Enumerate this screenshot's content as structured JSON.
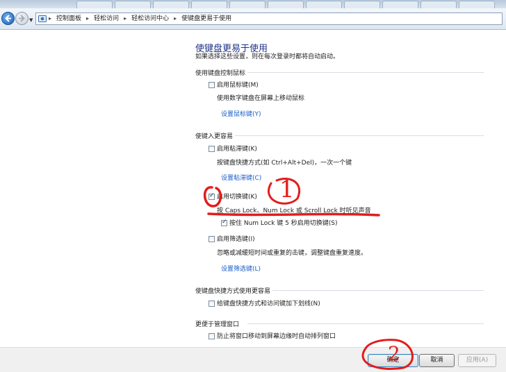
{
  "breadcrumbs": [
    "控制面板",
    "轻松访问",
    "轻松访问中心",
    "使键盘更易于使用"
  ],
  "header": {
    "title": "使键盘更易于使用",
    "subtitle": "如果选择这些设置，则在每次登录时都将自动启动。"
  },
  "sections": {
    "mouse_keys": {
      "heading": "使用键盘控制鼠标",
      "checkbox_label": "启用鼠标键(M)",
      "checked": false,
      "description": "使用数字键盘在屏幕上移动鼠标",
      "link": "设置鼠标键(Y)"
    },
    "easier_typing": {
      "heading": "使键入更容易",
      "sticky": {
        "checkbox_label": "启用粘滞键(K)",
        "checked": false,
        "description": "按键盘快捷方式(如 Ctrl+Alt+Del)，一次一个键",
        "link": "设置粘滞键(C)"
      },
      "toggle": {
        "checkbox_label": "启用切换键(K)",
        "checked": true,
        "description": "按 Caps Lock、Num Lock 或 Scroll Lock 时听见声音",
        "sub_checkbox_label": "按住 Num Lock 键 5 秒启用切换键(S)",
        "sub_checked": true
      },
      "filter": {
        "checkbox_label": "启用筛选键(I)",
        "checked": false,
        "description": "忽略或减缓短时间或重复的击键，调整键盘重复速度。",
        "link": "设置筛选键(L)"
      }
    },
    "shortcuts": {
      "heading": "使键盘快捷方式使用更容易",
      "checkbox_label": "给键盘快捷方式和访问键加下划线(N)",
      "checked": false
    },
    "windows": {
      "heading": "更便于管理窗口",
      "checkbox_label": "防止将窗口移动到屏幕边缘时自动排列窗口",
      "checked": false
    }
  },
  "footer": {
    "ok_label": "确定",
    "cancel_label": "取消",
    "apply_label": "应用(A)"
  },
  "annotations": {
    "marker_1": "1",
    "marker_2": "2",
    "color": "#e31c1c"
  }
}
